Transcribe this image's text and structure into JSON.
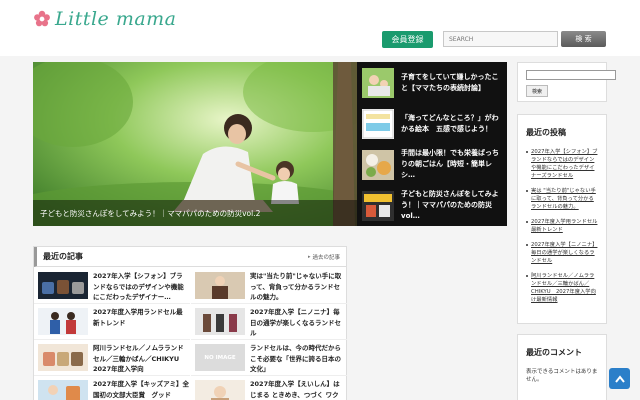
{
  "header": {
    "logo_text": "Little mama",
    "register_label": "会員登録",
    "search_placeholder": "SEARCH",
    "search_button": "検 索"
  },
  "slider": {
    "main_caption": "子どもと防災さんぽをしてみよう！｜ママパパのための防災vol.2",
    "items": [
      {
        "title": "子育てをしていて嫌しかったこと【ママたちの表続討論】"
      },
      {
        "title": "「海ってどんなところ？」がわかる絵本　五感で感じよう！"
      },
      {
        "title": "手間は最小限！でも栄養ばっちりの朝ごはん【時短・簡単レシ…"
      },
      {
        "title": "子どもと防災さんぽをしてみよう！｜ママパパのための防災vol…"
      }
    ]
  },
  "recent": {
    "title": "最近の記事",
    "more_label": "過去の記事",
    "posts": [
      {
        "title": "2027年入学【シフォン】ブランドならではのデザインや機能にこだわったデザイナー…"
      },
      {
        "title": "実は\"当たり前\"じゃない手に取って、背負って分かるランドセルの魅力。"
      },
      {
        "title": "2027年度入学用ランドセル最新トレンド"
      },
      {
        "title": "2027年度入学【ニノニナ】毎日の通学が楽しくなるランドセル"
      },
      {
        "title": "阿川ランドセル／ノムラランドセル／三輪かばん／CHIKYU　2027年度入学向"
      },
      {
        "title": "ランドセルは、今の時代だからこそ必要な「世界に誇る日本の文化」"
      },
      {
        "title": "2027年度入学【キッズアミ】全国初の文部大臣賞　グッド"
      },
      {
        "title": "2027年度入学【えいしん】はじまる ときめき、つづく ワク"
      }
    ],
    "noimage_label": "NO IMAGE"
  },
  "sidebar": {
    "search_button": "検索",
    "posts_title": "最近の投稿",
    "posts": [
      "2027年入学【シフォン】ブランドならではのデザインや機能にこだわったデザイナーズランドセル",
      "実は \"当たり前\"じゃない手に取って、背負って分かるランドセルの魅力。",
      "2027年度入学用ランドセル最新トレンド",
      "2027年度入学【ニノニナ】毎日の通学が楽しくなるランドセル",
      "阿川ランドセル／ノムラランドセル／三輪かばん／CHIKYU　2027年度入学向け最新情報"
    ],
    "comments_title": "最近のコメント",
    "comments_text": "表示できるコメントはありません。"
  },
  "colors": {
    "brand_green": "#3aa88e",
    "register_green": "#1a9b6e",
    "flower_pink": "#e8738a",
    "top_button_blue": "#2b7fc9"
  }
}
